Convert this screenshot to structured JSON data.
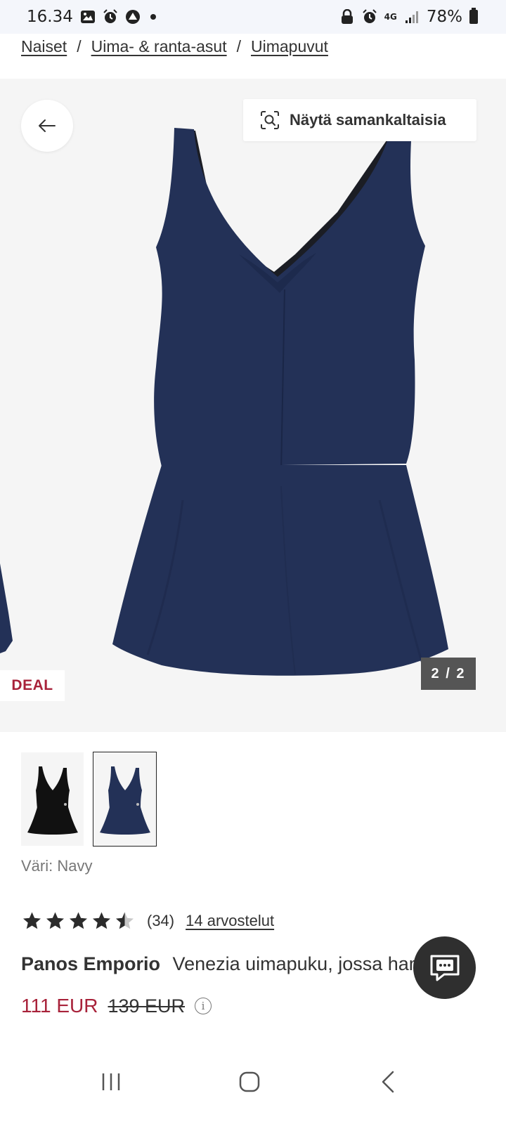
{
  "status_bar": {
    "time": "16.34",
    "network": "4G",
    "battery": "78%"
  },
  "breadcrumb": {
    "items": [
      "Naiset",
      "Uima- & ranta-asut",
      "Uimapuvut"
    ],
    "separator": "/"
  },
  "gallery": {
    "similar_label": "Näytä samankaltaisia",
    "deal_label": "DEAL",
    "counter": "2 / 2",
    "dress_color": "#233157"
  },
  "thumbnails": [
    {
      "color": "#111111",
      "selected": false
    },
    {
      "color": "#233157",
      "selected": true
    }
  ],
  "color_label": "Väri: Navy",
  "rating": {
    "value": 4.5,
    "max": 5,
    "count": "(34)",
    "reviews_link": "14 arvostelut"
  },
  "product": {
    "brand": "Panos Emporio",
    "name": "Venezia uimapuku, jossa hame"
  },
  "price": {
    "current": "111 EUR",
    "original": "139 EUR",
    "accent_color": "#a8223a"
  }
}
